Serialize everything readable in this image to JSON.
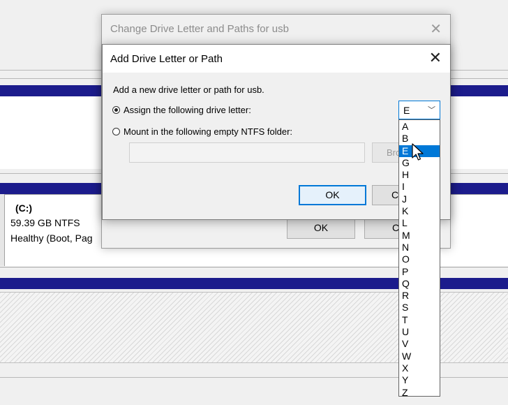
{
  "disk": {
    "partition_name": "(C:)",
    "partition_size": "59.39 GB NTFS",
    "partition_status": "Healthy (Boot, Pag"
  },
  "outer_dialog": {
    "title": "Change Drive Letter and Paths for usb",
    "ok_label": "OK",
    "cancel_label": "Ca"
  },
  "inner_dialog": {
    "title": "Add Drive Letter or Path",
    "description": "Add a new drive letter or path for usb.",
    "assign_label": "Assign the following drive letter:",
    "mount_label": "Mount in the following empty NTFS folder:",
    "path_value": "",
    "browse_label": "Bro",
    "ok_label": "OK",
    "cancel_label": "C"
  },
  "drive_letter": {
    "selected": "E",
    "options": [
      "A",
      "B",
      "E",
      "G",
      "H",
      "I",
      "J",
      "K",
      "L",
      "M",
      "N",
      "O",
      "P",
      "Q",
      "R",
      "S",
      "T",
      "U",
      "V",
      "W",
      "X",
      "Y",
      "Z"
    ],
    "highlighted": "E"
  }
}
